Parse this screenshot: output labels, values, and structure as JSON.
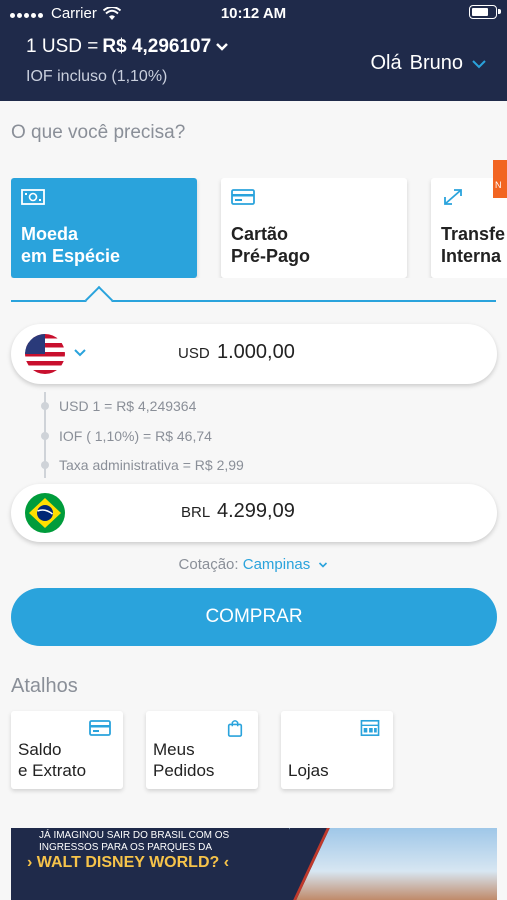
{
  "status_bar": {
    "carrier": "Carrier",
    "time": "10:12 AM"
  },
  "header": {
    "rate_prefix": "1 USD =",
    "rate_value": "R$ 4,296107",
    "rate_note": "IOF incluso (1,10%)",
    "greeting": "Olá",
    "user_name": "Bruno"
  },
  "main": {
    "question": "O que você precisa?",
    "products": [
      {
        "label": "Moeda\nem Espécie",
        "icon": "cash-icon",
        "active": true
      },
      {
        "label": "Cartão\nPré-Pago",
        "icon": "card-icon",
        "active": false
      },
      {
        "label": "Transfe\nInterna",
        "icon": "transfer-icon",
        "active": false
      }
    ],
    "new_badge": "N"
  },
  "converter": {
    "from_code": "USD",
    "from_value": "1.000,00",
    "to_code": "BRL",
    "to_value": "4.299,09",
    "details": [
      "USD 1 = R$  4,249364",
      "IOF ( 1,10%) = R$  46,74",
      "Taxa administrativa = R$  2,99"
    ],
    "cotacao_label": "Cotação:",
    "cotacao_city": "Campinas",
    "buy_label": "COMPRAR"
  },
  "shortcuts": {
    "title": "Atalhos",
    "items": [
      {
        "label": "Saldo\ne Extrato",
        "icon": "card-icon"
      },
      {
        "label": "Meus\nPedidos",
        "icon": "shopping-bag-icon"
      },
      {
        "label": "Lojas",
        "icon": "store-icon"
      }
    ]
  },
  "banner": {
    "line1": "JÁ IMAGINOU SAIR DO BRASIL COM OS\nINGRESSOS PARA OS PARQUES DA",
    "line2": "› WALT DISNEY WORLD? ‹"
  },
  "colors": {
    "navy": "#1f2a4a",
    "accent": "#2aa3dc",
    "badge": "#f26522"
  }
}
